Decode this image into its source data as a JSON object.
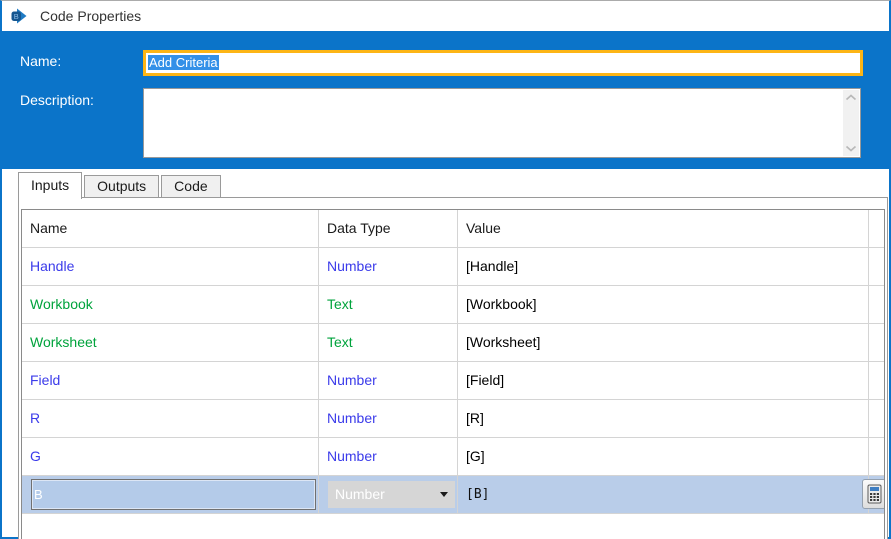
{
  "window": {
    "title": "Code Properties"
  },
  "colors": {
    "accent_blue": "#0b74c9",
    "focus_gold": "#fdb515",
    "text_selection_bg": "#3390e8",
    "selected_row_bg": "#b9cde9",
    "type_number": "#3b3bea",
    "type_text": "#00a33c"
  },
  "form": {
    "name_label": "Name:",
    "name_value": "Add Criteria",
    "description_label": "Description:",
    "description_value": ""
  },
  "tabs": [
    {
      "label": "Inputs",
      "active": true
    },
    {
      "label": "Outputs",
      "active": false
    },
    {
      "label": "Code",
      "active": false
    }
  ],
  "inputs_table": {
    "columns": [
      "Name",
      "Data Type",
      "Value"
    ],
    "rows": [
      {
        "name": "Handle",
        "data_type": "Number",
        "value": "[Handle]",
        "selected": false
      },
      {
        "name": "Workbook",
        "data_type": "Text",
        "value": "[Workbook]",
        "selected": false
      },
      {
        "name": "Worksheet",
        "data_type": "Text",
        "value": "[Worksheet]",
        "selected": false
      },
      {
        "name": "Field",
        "data_type": "Number",
        "value": "[Field]",
        "selected": false
      },
      {
        "name": "R",
        "data_type": "Number",
        "value": "[R]",
        "selected": false
      },
      {
        "name": "G",
        "data_type": "Number",
        "value": "[G]",
        "selected": false
      },
      {
        "name": "B",
        "data_type": "Number",
        "value": "[B]",
        "selected": true
      }
    ]
  },
  "icons": {
    "title": "code-stage-icon",
    "scroll_up": "chevron-up-icon",
    "scroll_down": "chevron-down-icon",
    "dropdown": "chevron-down-arrow",
    "expression_button": "calculator-icon"
  }
}
